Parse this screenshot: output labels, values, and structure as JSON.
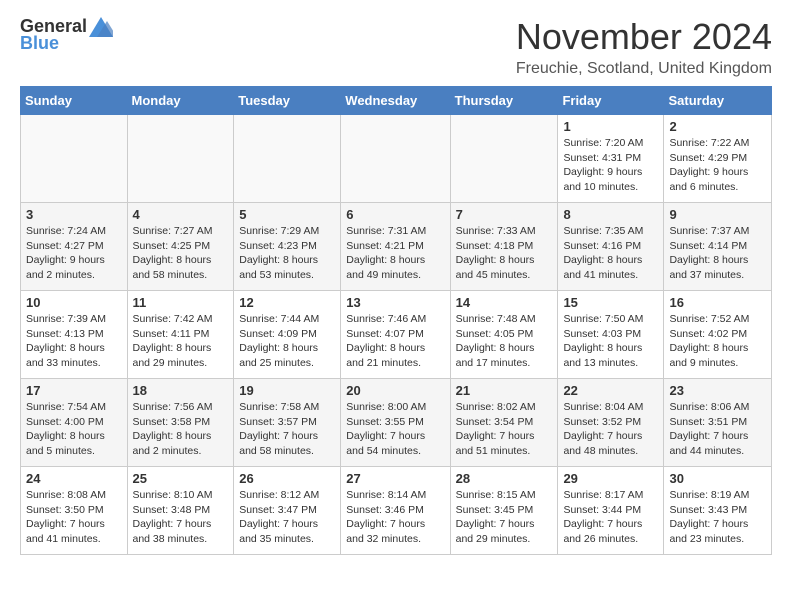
{
  "header": {
    "logo_general": "General",
    "logo_blue": "Blue",
    "month_title": "November 2024",
    "location": "Freuchie, Scotland, United Kingdom"
  },
  "days_of_week": [
    "Sunday",
    "Monday",
    "Tuesday",
    "Wednesday",
    "Thursday",
    "Friday",
    "Saturday"
  ],
  "weeks": [
    [
      {
        "num": "",
        "info": ""
      },
      {
        "num": "",
        "info": ""
      },
      {
        "num": "",
        "info": ""
      },
      {
        "num": "",
        "info": ""
      },
      {
        "num": "",
        "info": ""
      },
      {
        "num": "1",
        "info": "Sunrise: 7:20 AM\nSunset: 4:31 PM\nDaylight: 9 hours and 10 minutes."
      },
      {
        "num": "2",
        "info": "Sunrise: 7:22 AM\nSunset: 4:29 PM\nDaylight: 9 hours and 6 minutes."
      }
    ],
    [
      {
        "num": "3",
        "info": "Sunrise: 7:24 AM\nSunset: 4:27 PM\nDaylight: 9 hours and 2 minutes."
      },
      {
        "num": "4",
        "info": "Sunrise: 7:27 AM\nSunset: 4:25 PM\nDaylight: 8 hours and 58 minutes."
      },
      {
        "num": "5",
        "info": "Sunrise: 7:29 AM\nSunset: 4:23 PM\nDaylight: 8 hours and 53 minutes."
      },
      {
        "num": "6",
        "info": "Sunrise: 7:31 AM\nSunset: 4:21 PM\nDaylight: 8 hours and 49 minutes."
      },
      {
        "num": "7",
        "info": "Sunrise: 7:33 AM\nSunset: 4:18 PM\nDaylight: 8 hours and 45 minutes."
      },
      {
        "num": "8",
        "info": "Sunrise: 7:35 AM\nSunset: 4:16 PM\nDaylight: 8 hours and 41 minutes."
      },
      {
        "num": "9",
        "info": "Sunrise: 7:37 AM\nSunset: 4:14 PM\nDaylight: 8 hours and 37 minutes."
      }
    ],
    [
      {
        "num": "10",
        "info": "Sunrise: 7:39 AM\nSunset: 4:13 PM\nDaylight: 8 hours and 33 minutes."
      },
      {
        "num": "11",
        "info": "Sunrise: 7:42 AM\nSunset: 4:11 PM\nDaylight: 8 hours and 29 minutes."
      },
      {
        "num": "12",
        "info": "Sunrise: 7:44 AM\nSunset: 4:09 PM\nDaylight: 8 hours and 25 minutes."
      },
      {
        "num": "13",
        "info": "Sunrise: 7:46 AM\nSunset: 4:07 PM\nDaylight: 8 hours and 21 minutes."
      },
      {
        "num": "14",
        "info": "Sunrise: 7:48 AM\nSunset: 4:05 PM\nDaylight: 8 hours and 17 minutes."
      },
      {
        "num": "15",
        "info": "Sunrise: 7:50 AM\nSunset: 4:03 PM\nDaylight: 8 hours and 13 minutes."
      },
      {
        "num": "16",
        "info": "Sunrise: 7:52 AM\nSunset: 4:02 PM\nDaylight: 8 hours and 9 minutes."
      }
    ],
    [
      {
        "num": "17",
        "info": "Sunrise: 7:54 AM\nSunset: 4:00 PM\nDaylight: 8 hours and 5 minutes."
      },
      {
        "num": "18",
        "info": "Sunrise: 7:56 AM\nSunset: 3:58 PM\nDaylight: 8 hours and 2 minutes."
      },
      {
        "num": "19",
        "info": "Sunrise: 7:58 AM\nSunset: 3:57 PM\nDaylight: 7 hours and 58 minutes."
      },
      {
        "num": "20",
        "info": "Sunrise: 8:00 AM\nSunset: 3:55 PM\nDaylight: 7 hours and 54 minutes."
      },
      {
        "num": "21",
        "info": "Sunrise: 8:02 AM\nSunset: 3:54 PM\nDaylight: 7 hours and 51 minutes."
      },
      {
        "num": "22",
        "info": "Sunrise: 8:04 AM\nSunset: 3:52 PM\nDaylight: 7 hours and 48 minutes."
      },
      {
        "num": "23",
        "info": "Sunrise: 8:06 AM\nSunset: 3:51 PM\nDaylight: 7 hours and 44 minutes."
      }
    ],
    [
      {
        "num": "24",
        "info": "Sunrise: 8:08 AM\nSunset: 3:50 PM\nDaylight: 7 hours and 41 minutes."
      },
      {
        "num": "25",
        "info": "Sunrise: 8:10 AM\nSunset: 3:48 PM\nDaylight: 7 hours and 38 minutes."
      },
      {
        "num": "26",
        "info": "Sunrise: 8:12 AM\nSunset: 3:47 PM\nDaylight: 7 hours and 35 minutes."
      },
      {
        "num": "27",
        "info": "Sunrise: 8:14 AM\nSunset: 3:46 PM\nDaylight: 7 hours and 32 minutes."
      },
      {
        "num": "28",
        "info": "Sunrise: 8:15 AM\nSunset: 3:45 PM\nDaylight: 7 hours and 29 minutes."
      },
      {
        "num": "29",
        "info": "Sunrise: 8:17 AM\nSunset: 3:44 PM\nDaylight: 7 hours and 26 minutes."
      },
      {
        "num": "30",
        "info": "Sunrise: 8:19 AM\nSunset: 3:43 PM\nDaylight: 7 hours and 23 minutes."
      }
    ]
  ]
}
